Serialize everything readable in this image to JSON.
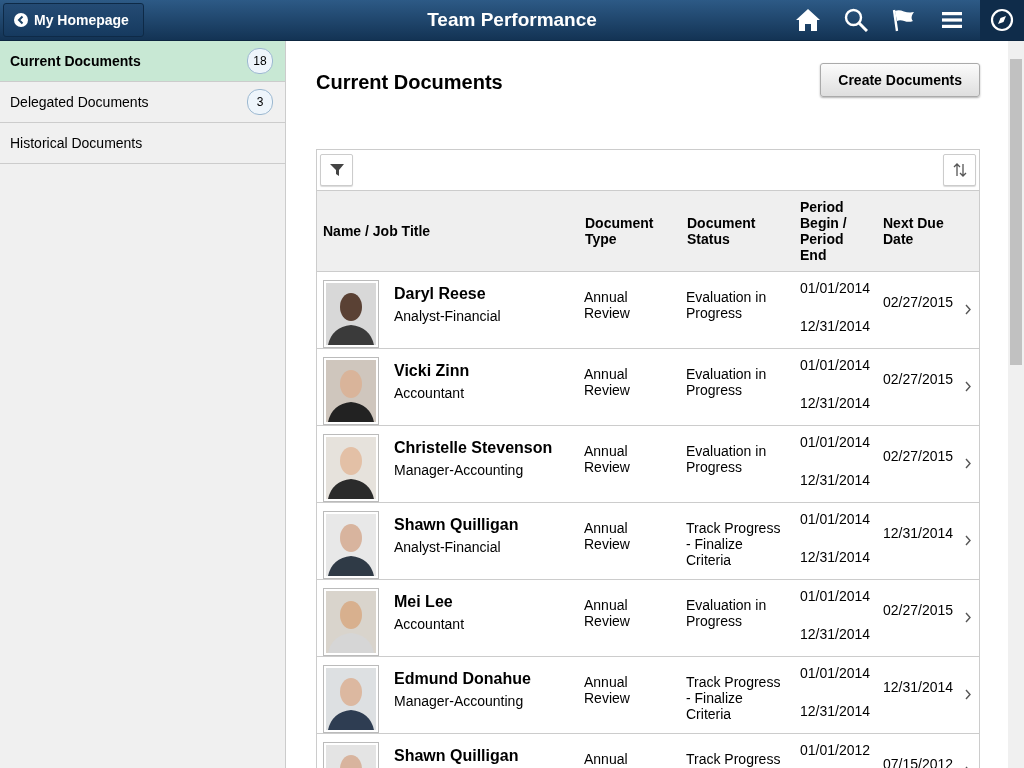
{
  "header": {
    "back_label": "My Homepage",
    "title": "Team Performance"
  },
  "sidebar": {
    "items": [
      {
        "label": "Current Documents",
        "count": "18",
        "selected": true
      },
      {
        "label": "Delegated Documents",
        "count": "3",
        "selected": false
      },
      {
        "label": "Historical Documents",
        "selected": false
      }
    ]
  },
  "page": {
    "title": "Current Documents",
    "create_button": "Create Documents"
  },
  "table": {
    "columns": [
      "Name / Job Title",
      "Document Type",
      "Document Status",
      "Period Begin / Period End",
      "Next Due Date"
    ],
    "rows": [
      {
        "name": "Daryl Reese",
        "job_title": "Analyst-Financial",
        "type": "Annual Review",
        "status": "Evaluation in Progress",
        "begin": "01/01/2014",
        "end": "12/31/2014",
        "due": "02/27/2015"
      },
      {
        "name": "Vicki Zinn",
        "job_title": "Accountant",
        "type": "Annual Review",
        "status": "Evaluation in Progress",
        "begin": "01/01/2014",
        "end": "12/31/2014",
        "due": "02/27/2015"
      },
      {
        "name": "Christelle Stevenson",
        "job_title": "Manager-Accounting",
        "type": "Annual Review",
        "status": "Evaluation in Progress",
        "begin": "01/01/2014",
        "end": "12/31/2014",
        "due": "02/27/2015"
      },
      {
        "name": "Shawn Quilligan",
        "job_title": "Analyst-Financial",
        "type": "Annual Review",
        "status": "Track Progress - Finalize Criteria",
        "begin": "01/01/2014",
        "end": "12/31/2014",
        "due": "12/31/2014"
      },
      {
        "name": "Mei Lee",
        "job_title": "Accountant",
        "type": "Annual Review",
        "status": "Evaluation in Progress",
        "begin": "01/01/2014",
        "end": "12/31/2014",
        "due": "02/27/2015"
      },
      {
        "name": "Edmund Donahue",
        "job_title": "Manager-Accounting",
        "type": "Annual Review",
        "status": "Track Progress - Finalize Criteria",
        "begin": "01/01/2014",
        "end": "12/31/2014",
        "due": "12/31/2014"
      },
      {
        "name": "Shawn Quilligan",
        "type": "Annual",
        "status": "Track Progress",
        "begin": "01/01/2012",
        "due": "07/15/2012"
      }
    ]
  }
}
